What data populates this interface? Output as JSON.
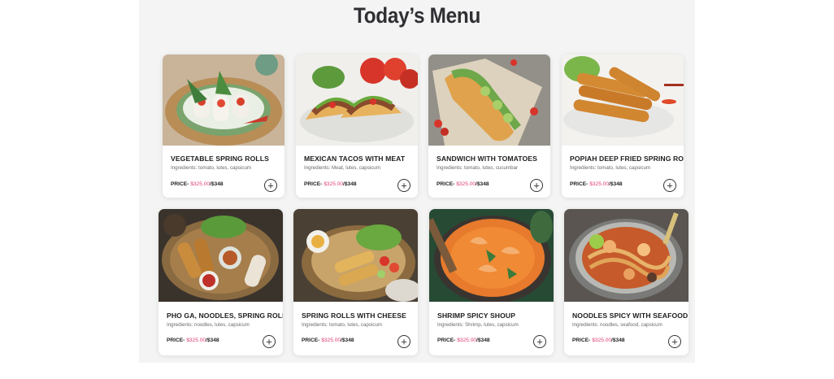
{
  "page": {
    "title": "Today’s Menu"
  },
  "price_label": "PRICE-",
  "items": [
    {
      "name": "VEGETABLE SPRING ROLLS",
      "ingredients": "Ingredients: tomato, lutes, capsicum",
      "old_price": "$325.00",
      "price": "/$348"
    },
    {
      "name": "MEXICAN TACOS WITH MEAT",
      "ingredients": "Ingredients: Meat, lutes, capsicum",
      "old_price": "$325.00",
      "price": "/$348"
    },
    {
      "name": "SANDWICH WITH TOMATOES",
      "ingredients": "Ingredients: tomato, lutes, cucumbar",
      "old_price": "$325.00",
      "price": "/$348"
    },
    {
      "name": "POPIAH DEEP FRIED SPRING ROLLS",
      "ingredients": "Ingredients: tomato, lutes, capsicum",
      "old_price": "$325.00",
      "price": "/$348"
    },
    {
      "name": "PHO GA, NOODLES, SPRING ROLLS",
      "ingredients": "Ingredients: noodles, lutes, capsicum",
      "old_price": "$325.00",
      "price": "/$348"
    },
    {
      "name": "SPRING ROLLS WITH CHEESE",
      "ingredients": "Ingredients: tomato, lutes, capsicum",
      "old_price": "$325.00",
      "price": "/$348"
    },
    {
      "name": "SHRIMP SPICY SHOUP",
      "ingredients": "Ingredients: Shrimp, lutes, capsicum",
      "old_price": "$325.00",
      "price": "/$348"
    },
    {
      "name": "NOODLES SPICY WITH SEAFOOD",
      "ingredients": "Ingredients: noodles, seafood, capsicum",
      "old_price": "$325.00",
      "price": "/$348"
    }
  ],
  "icons": {
    "add": "plus-circle-icon"
  },
  "colors": {
    "accent": "#e0407a",
    "text": "#1d1d1f",
    "panel": "#f3f4f3"
  }
}
